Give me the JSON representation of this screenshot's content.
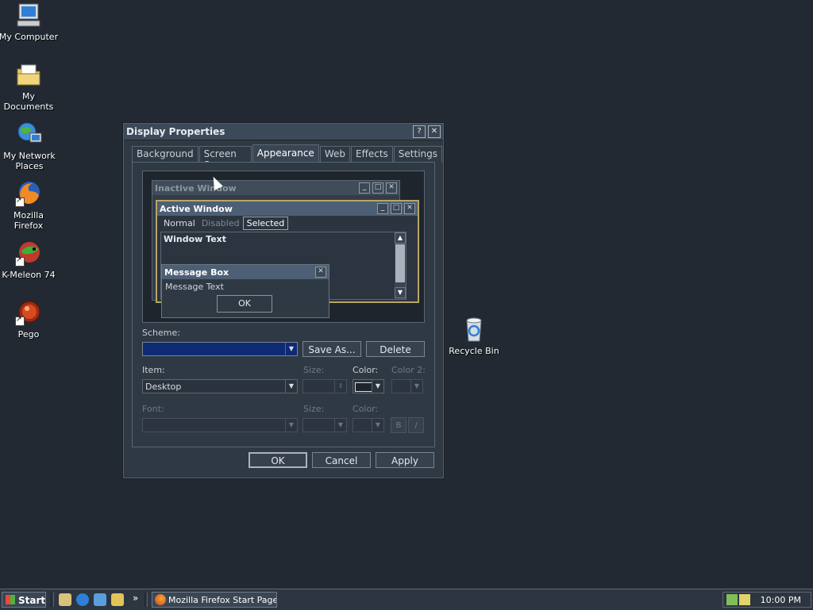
{
  "desktop": {
    "icons": [
      {
        "label": "My Computer"
      },
      {
        "label": "My Documents"
      },
      {
        "label": "My Network Places"
      },
      {
        "label": "Mozilla Firefox"
      },
      {
        "label": "K-Meleon 74"
      },
      {
        "label": "Pego"
      },
      {
        "label": "Recycle Bin"
      }
    ]
  },
  "dialog": {
    "title": "Display Properties",
    "help_label": "?",
    "close_label": "✕",
    "tabs": [
      "Background",
      "Screen Saver",
      "Appearance",
      "Web",
      "Effects",
      "Settings"
    ],
    "active_tab": "Appearance",
    "preview": {
      "inactive_title": "Inactive Window",
      "active_title": "Active Window",
      "menu_normal": "Normal",
      "menu_disabled": "Disabled",
      "menu_selected": "Selected",
      "window_text": "Window Text",
      "msgbox_title": "Message Box",
      "msgbox_text": "Message Text",
      "msgbox_ok": "OK"
    },
    "scheme": {
      "label": "Scheme:",
      "value": "",
      "save_as": "Save As...",
      "delete": "Delete"
    },
    "item": {
      "label": "Item:",
      "value": "Desktop",
      "size_label": "Size:",
      "color_label": "Color:",
      "color2_label": "Color 2:",
      "color_value": "#1e252d"
    },
    "font": {
      "label": "Font:",
      "size_label": "Size:",
      "color_label": "Color:",
      "bold_label": "B",
      "italic_label": "/"
    },
    "buttons": {
      "ok": "OK",
      "cancel": "Cancel",
      "apply": "Apply"
    }
  },
  "taskbar": {
    "start_label": "Start",
    "chevron": "»",
    "task_label": "Mozilla Firefox Start Page...",
    "clock": "10:00 PM"
  }
}
